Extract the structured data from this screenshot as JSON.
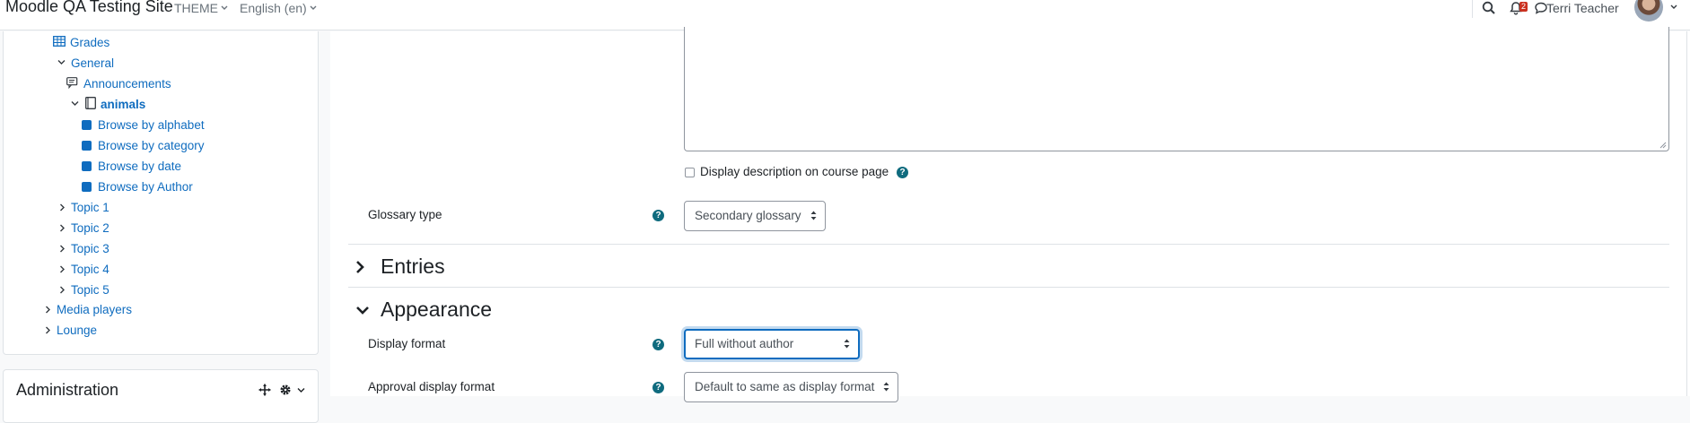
{
  "navbar": {
    "site_name": "Moodle QA Testing Site",
    "theme_label": "THEME",
    "language_label": "English (en)",
    "notification_count": "2",
    "user_name": "Terri Teacher"
  },
  "drawer": {
    "items": [
      {
        "label": "Grades"
      },
      {
        "label": "General"
      },
      {
        "label": "Announcements"
      },
      {
        "label": "animals"
      },
      {
        "label": "Browse by alphabet"
      },
      {
        "label": "Browse by category"
      },
      {
        "label": "Browse by date"
      },
      {
        "label": "Browse by Author"
      },
      {
        "label": "Topic 1"
      },
      {
        "label": "Topic 2"
      },
      {
        "label": "Topic 3"
      },
      {
        "label": "Topic 4"
      },
      {
        "label": "Topic 5"
      },
      {
        "label": "Media players"
      },
      {
        "label": "Lounge"
      }
    ],
    "admin_title": "Administration"
  },
  "form": {
    "display_description_label": "Display description on course page",
    "display_description_checked": false,
    "glossary_type_label": "Glossary type",
    "glossary_type_value": "Secondary glossary",
    "entries_header": "Entries",
    "appearance_header": "Appearance",
    "display_format_label": "Display format",
    "display_format_value": "Full without author",
    "approval_format_label": "Approval display format",
    "approval_format_value": "Default to same as display format"
  },
  "colors": {
    "link": "#0f6cbf",
    "help_icon": "#0f6b7e",
    "badge": "#ca3120"
  }
}
